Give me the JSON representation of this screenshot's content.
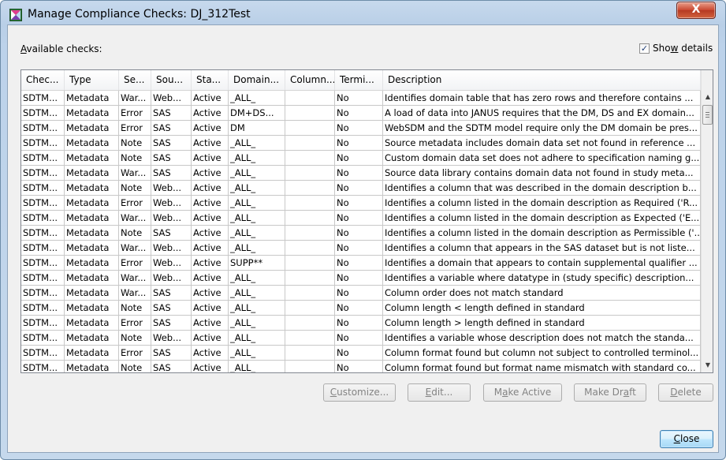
{
  "window": {
    "title": "Manage Compliance Checks: DJ_312Test",
    "icon": "app-icon",
    "close_label": "X"
  },
  "available_label": "Available checks:",
  "show_details": {
    "label": "Show details",
    "checked": true
  },
  "table": {
    "columns": [
      "Chec...",
      "Type",
      "Se...",
      "Sou...",
      "Sta...",
      "Domain...",
      "Column...",
      "Termi...",
      "Description"
    ],
    "rows": [
      [
        "SDTM...",
        "Metadata",
        "War...",
        "Web...",
        "Active",
        "_ALL_",
        "",
        "No",
        "Identifies domain table that has zero rows and therefore contains ..."
      ],
      [
        "SDTM...",
        "Metadata",
        "Error",
        "SAS",
        "Active",
        "DM+DS...",
        "",
        "No",
        "A load of data into JANUS requires that the DM, DS and EX domain..."
      ],
      [
        "SDTM...",
        "Metadata",
        "Error",
        "SAS",
        "Active",
        "DM",
        "",
        "No",
        "WebSDM and the SDTM model require only the DM domain be pres..."
      ],
      [
        "SDTM...",
        "Metadata",
        "Note",
        "SAS",
        "Active",
        "_ALL_",
        "",
        "No",
        "Source metadata includes domain data set not found in reference ..."
      ],
      [
        "SDTM...",
        "Metadata",
        "Note",
        "SAS",
        "Active",
        "_ALL_",
        "",
        "No",
        "Custom domain data set does not adhere to specification naming g..."
      ],
      [
        "SDTM...",
        "Metadata",
        "War...",
        "SAS",
        "Active",
        "_ALL_",
        "",
        "No",
        "Source data library contains domain data not found in study meta..."
      ],
      [
        "SDTM...",
        "Metadata",
        "Note",
        "Web...",
        "Active",
        "_ALL_",
        "",
        "No",
        "Identifies a column that was described in the domain description b..."
      ],
      [
        "SDTM...",
        "Metadata",
        "Error",
        "Web...",
        "Active",
        "_ALL_",
        "",
        "No",
        "Identifies a column listed in the domain description as Required ('R..."
      ],
      [
        "SDTM...",
        "Metadata",
        "War...",
        "Web...",
        "Active",
        "_ALL_",
        "",
        "No",
        "Identifies a column listed in the domain description as Expected ('E..."
      ],
      [
        "SDTM...",
        "Metadata",
        "Note",
        "SAS",
        "Active",
        "_ALL_",
        "",
        "No",
        "Identifies a column listed in the domain description as Permissible ('..."
      ],
      [
        "SDTM...",
        "Metadata",
        "War...",
        "Web...",
        "Active",
        "_ALL_",
        "",
        "No",
        "Identifies a column that appears in the SAS dataset but is not liste..."
      ],
      [
        "SDTM...",
        "Metadata",
        "Error",
        "Web...",
        "Active",
        "SUPP**",
        "",
        "No",
        "Identifies a domain that appears to contain supplemental qualifier ..."
      ],
      [
        "SDTM...",
        "Metadata",
        "War...",
        "Web...",
        "Active",
        "_ALL_",
        "",
        "No",
        "Identifies a variable where datatype in (study specific) description..."
      ],
      [
        "SDTM...",
        "Metadata",
        "War...",
        "SAS",
        "Active",
        "_ALL_",
        "",
        "No",
        "Column order does not match standard"
      ],
      [
        "SDTM...",
        "Metadata",
        "Note",
        "SAS",
        "Active",
        "_ALL_",
        "",
        "No",
        "Column length < length defined in standard"
      ],
      [
        "SDTM...",
        "Metadata",
        "Error",
        "SAS",
        "Active",
        "_ALL_",
        "",
        "No",
        "Column length > length defined in standard"
      ],
      [
        "SDTM...",
        "Metadata",
        "Note",
        "Web...",
        "Active",
        "_ALL_",
        "",
        "No",
        "Identifies a variable whose description does not match the standa..."
      ],
      [
        "SDTM...",
        "Metadata",
        "Error",
        "SAS",
        "Active",
        "_ALL_",
        "",
        "No",
        "Column format found but column not subject to controlled terminol..."
      ],
      [
        "SDTM...",
        "Metadata",
        "Note",
        "SAS",
        "Active",
        "_ALL_",
        "",
        "No",
        "Column format found but format name mismatch with standard co..."
      ]
    ]
  },
  "buttons": {
    "customize": "Customize...",
    "edit": "Edit...",
    "make_active": "Make Active",
    "make_draft": "Make Draft",
    "delete": "Delete",
    "close": "Close"
  }
}
